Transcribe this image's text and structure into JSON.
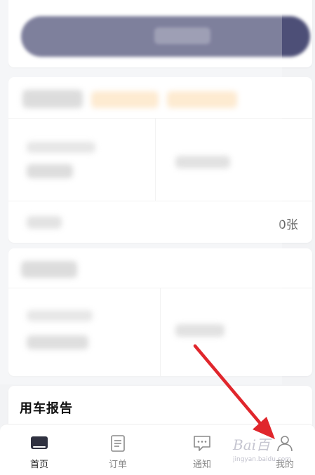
{
  "cards": {
    "mid_suffix_text": "0张",
    "report_title": "用车报告"
  },
  "tabbar": {
    "tabs": [
      {
        "id": "home",
        "label": "首页",
        "icon": "home-icon",
        "active": true
      },
      {
        "id": "orders",
        "label": "订单",
        "icon": "document-icon",
        "active": false
      },
      {
        "id": "notify",
        "label": "通知",
        "icon": "chat-icon",
        "active": false
      },
      {
        "id": "mine",
        "label": "我的",
        "icon": "person-icon",
        "active": false
      }
    ]
  },
  "watermark": {
    "main": "Bai百",
    "sub": "jingyan.baidu.com"
  },
  "colors": {
    "primary": "#4d4f77",
    "accent_orange": "#f7b86a",
    "arrow": "#e0262c",
    "background": "#f2f3f5"
  }
}
